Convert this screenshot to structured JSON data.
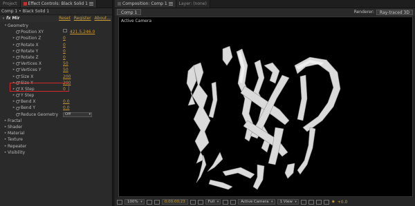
{
  "left_panel": {
    "tabs": [
      {
        "label": "Project"
      },
      {
        "label": "Effect Controls: Black Solid 1"
      }
    ],
    "breadcrumb": "Comp 1 • Black Solid 1",
    "effect": {
      "badge": "fx",
      "name": "Mir",
      "links": [
        "Reset",
        "Register",
        "About..."
      ]
    },
    "properties": [
      {
        "indent": 1,
        "twirl": "▾",
        "label": "Geometry",
        "type": "group"
      },
      {
        "indent": 2,
        "twirl": "",
        "label": "Position XY",
        "type": "xy",
        "value": "421.5,246.0"
      },
      {
        "indent": 2,
        "twirl": "▸",
        "label": "Position Z",
        "type": "num",
        "value": "0"
      },
      {
        "indent": 2,
        "twirl": "▸",
        "label": "Rotate X",
        "type": "num",
        "value": "0"
      },
      {
        "indent": 2,
        "twirl": "▸",
        "label": "Rotate Y",
        "type": "num",
        "value": "0"
      },
      {
        "indent": 2,
        "twirl": "▸",
        "label": "Rotate Z",
        "type": "num",
        "value": "0"
      },
      {
        "indent": 2,
        "twirl": "▸",
        "label": "Vertices X",
        "type": "num",
        "value": "50"
      },
      {
        "indent": 2,
        "twirl": "▸",
        "label": "Vertices Y",
        "type": "num",
        "value": "50"
      },
      {
        "indent": 2,
        "twirl": "▸",
        "label": "Size X",
        "type": "num",
        "value": "200"
      },
      {
        "indent": 2,
        "twirl": "▸",
        "label": "Size Y",
        "type": "num",
        "value": "200"
      },
      {
        "indent": 2,
        "twirl": "▸",
        "label": "X Step",
        "type": "num",
        "value": "0"
      },
      {
        "indent": 2,
        "twirl": "▸",
        "label": "Y Step",
        "type": "num",
        "value": ""
      },
      {
        "indent": 2,
        "twirl": "▸",
        "label": "Bend X",
        "type": "num",
        "value": "0.0"
      },
      {
        "indent": 2,
        "twirl": "▸",
        "label": "Bend Y",
        "type": "num",
        "value": "0.0"
      },
      {
        "indent": 2,
        "twirl": "",
        "label": "Reduce Geometry",
        "type": "select",
        "value": "Off"
      },
      {
        "indent": 1,
        "twirl": "▸",
        "label": "Fractal",
        "type": "group"
      },
      {
        "indent": 1,
        "twirl": "▸",
        "label": "Shader",
        "type": "group"
      },
      {
        "indent": 1,
        "twirl": "▸",
        "label": "Material",
        "type": "group"
      },
      {
        "indent": 1,
        "twirl": "▸",
        "label": "Texture",
        "type": "group"
      },
      {
        "indent": 1,
        "twirl": "▸",
        "label": "Repeater",
        "type": "group"
      },
      {
        "indent": 1,
        "twirl": "▸",
        "label": "Visibility",
        "type": "group"
      }
    ]
  },
  "right_panel": {
    "tabs": [
      {
        "label": "Composition: Comp 1"
      },
      {
        "label": "Layer: (none)"
      }
    ],
    "comp_subtab": "Comp 1",
    "renderer_label": "Renderer:",
    "renderer_value": "Ray-traced 3D",
    "viewer_label": "Active Camera",
    "bottom_bar": {
      "zoom": "100%",
      "timecode": "0;00;00;23",
      "resolution": "Full",
      "camera": "Active Camera",
      "views": "1 View",
      "exposure": "+0.0"
    }
  },
  "colors": {
    "accent_link": "#d0a030",
    "highlight_box": "#d82828",
    "viewer_bg": "#000000",
    "ribbon": "#e6e6e6"
  }
}
